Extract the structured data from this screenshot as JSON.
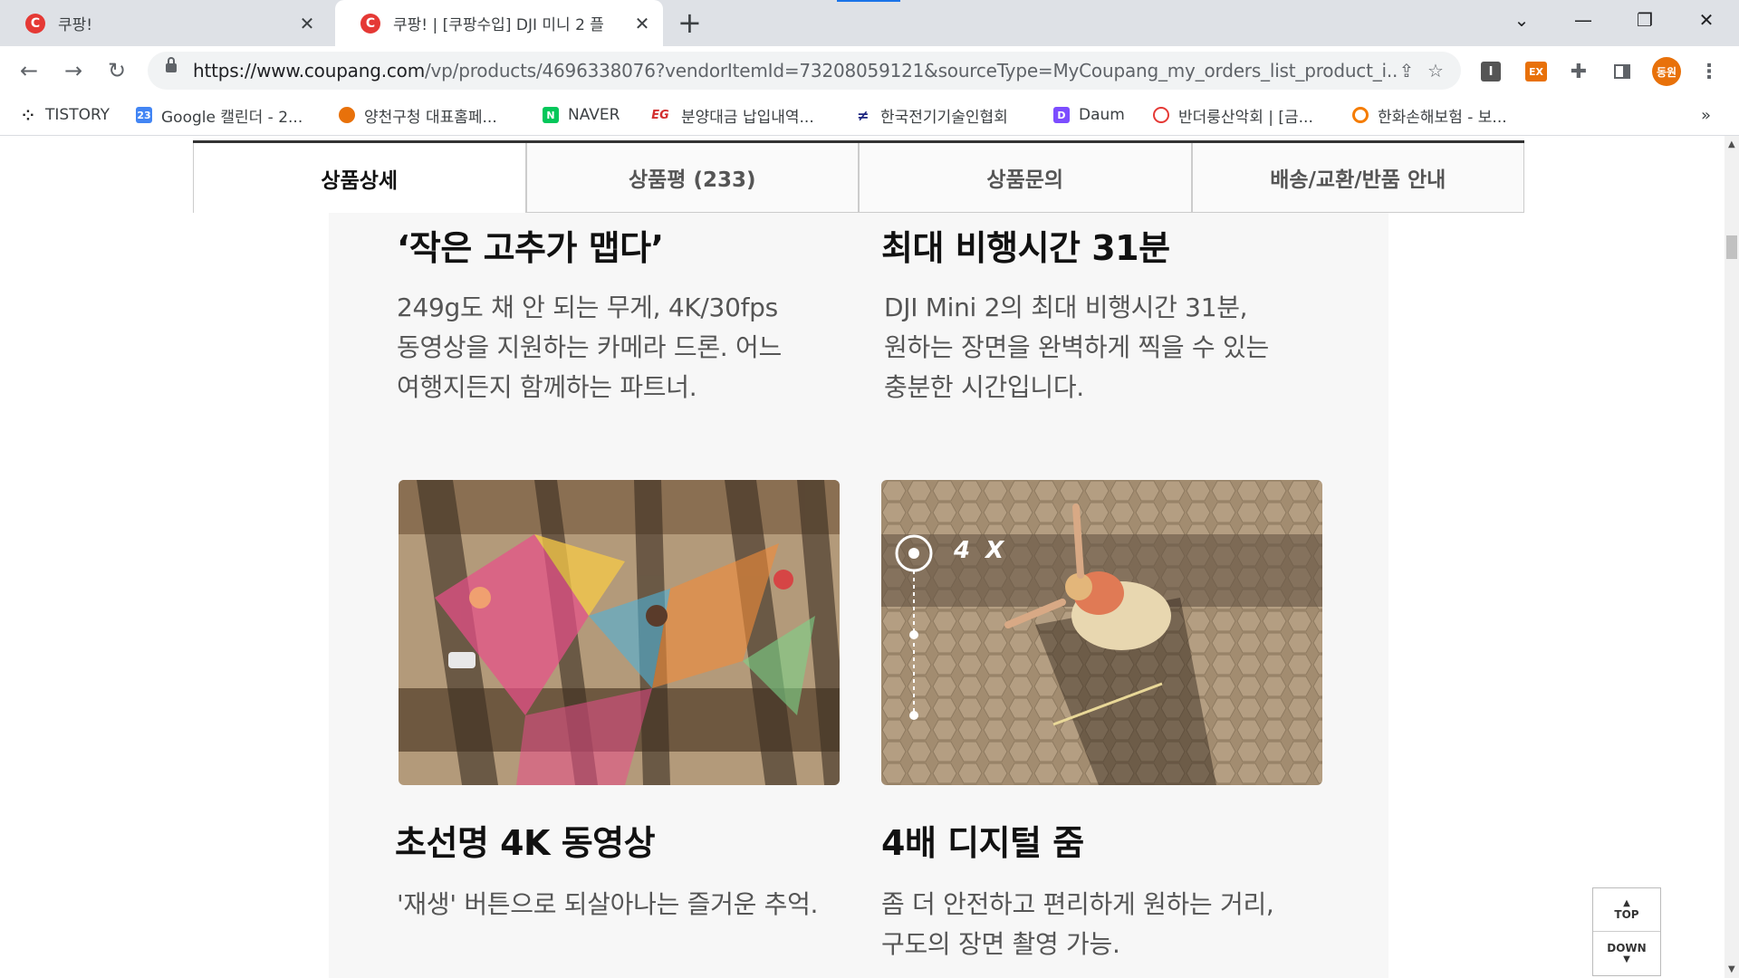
{
  "browser": {
    "tabs": [
      {
        "title": "쿠팡!",
        "favicon": "C"
      },
      {
        "title": "쿠팡! | [쿠팡수입] DJI 미니 2 플",
        "favicon": "C"
      }
    ],
    "url_host": "https://www.coupang.com",
    "url_path": "/vp/products/4696338076?vendorItemId=73208059121&sourceType=MyCoupang_my_orders_list_product_i...",
    "profile_label": "동원",
    "ext_ex_label": "EX",
    "ext_i_label": "I"
  },
  "bookmarks": [
    {
      "label": "TISTORY",
      "icon": "tistory-icon",
      "color": "#222222"
    },
    {
      "label": "Google 캘린더 - 2...",
      "icon": "calendar-icon",
      "color": "#4285f4",
      "glyph": "23"
    },
    {
      "label": "양천구청 대표홈페...",
      "icon": "yangcheon-icon",
      "color": "#e8710a"
    },
    {
      "label": "NAVER",
      "icon": "naver-icon",
      "color": "#03c75a",
      "glyph": "N"
    },
    {
      "label": "분양대금 납입내역...",
      "icon": "eg-icon",
      "color": "#d32f2f",
      "glyph": "EG"
    },
    {
      "label": "한국전기기술인협회",
      "icon": "kea-icon",
      "color": "#1a237e"
    },
    {
      "label": "Daum",
      "icon": "daum-icon",
      "color": "#7c4dff",
      "glyph": "D"
    },
    {
      "label": "반더룽산악회 | [금...",
      "icon": "club-icon",
      "color": "#e53935"
    },
    {
      "label": "한화손해보험 - 보...",
      "icon": "hanwha-icon",
      "color": "#f57c00"
    }
  ],
  "product_tabs": [
    "상품상세",
    "상품평 (233)",
    "상품문의",
    "배송/교환/반품 안내"
  ],
  "features": [
    {
      "title": "‘작은 고추가 맵다’",
      "lines": [
        "249g도 채 안 되는 무게, 4K/30fps",
        "동영상을 지원하는 카메라 드론. 어느",
        "여행지든지 함께하는 파트너."
      ]
    },
    {
      "title": "최대 비행시간 31분",
      "lines": [
        "DJI Mini 2의 최대 비행시간 31분,",
        "원하는 장면을 완벽하게 찍을 수 있는",
        "충분한 시간입니다."
      ]
    },
    {
      "title": "초선명 4K 동영상",
      "lines": [
        "'재생' 버튼으로 되살아나는 즐거운 추억."
      ]
    },
    {
      "title": "4배 디지털 줌",
      "lines": [
        "좀 더 안전하고 편리하게 원하는 거리,",
        "구도의 장면 촬영 가능."
      ]
    }
  ],
  "zoom_overlay": "4 X",
  "float_buttons": {
    "top": "TOP",
    "down": "DOWN"
  },
  "colors": {
    "accent": "#e53935",
    "tab_bg": "#dee1e6",
    "content_bg": "#f7f7f7"
  }
}
